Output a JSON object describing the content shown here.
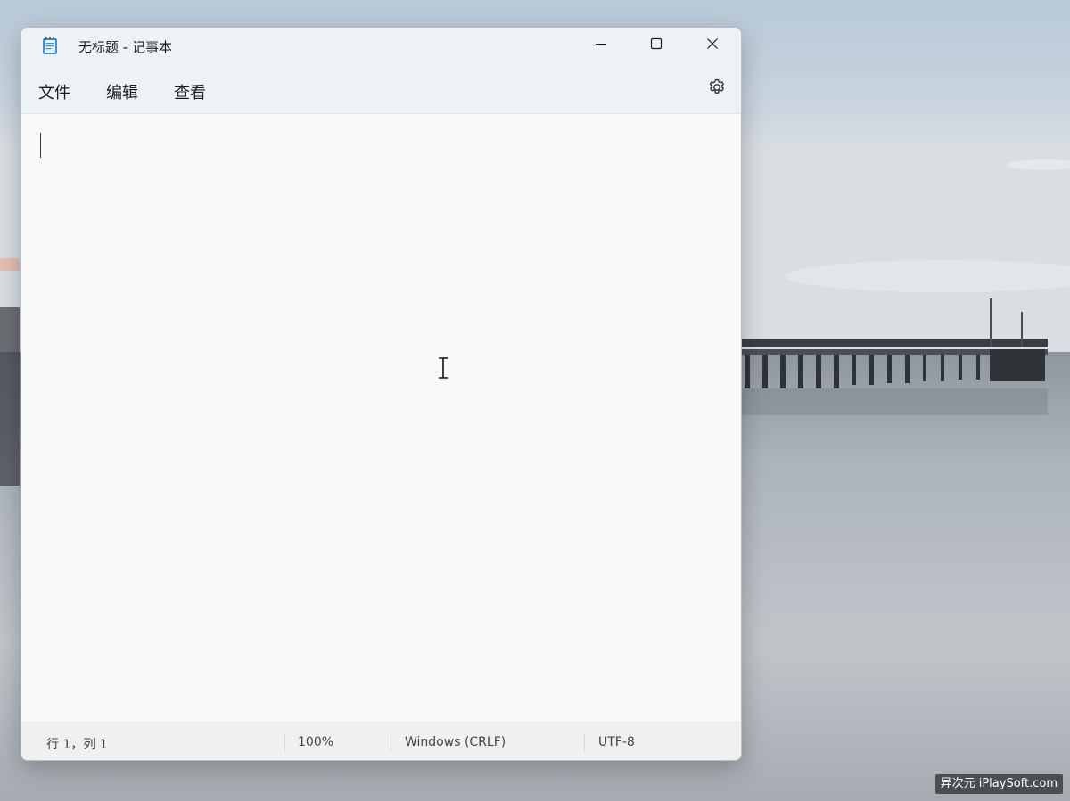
{
  "window": {
    "title": "无标题 - 记事本",
    "app_icon": "notepad-icon"
  },
  "caption_buttons": {
    "minimize": "minimize-icon",
    "maximize": "maximize-icon",
    "close": "close-icon"
  },
  "menu": {
    "items": [
      {
        "label": "文件"
      },
      {
        "label": "编辑"
      },
      {
        "label": "查看"
      }
    ],
    "settings_icon": "gear-icon"
  },
  "editor": {
    "content": ""
  },
  "statusbar": {
    "position": "行 1，列 1",
    "zoom": "100%",
    "line_ending": "Windows (CRLF)",
    "encoding": "UTF-8"
  },
  "watermark": "异次元 iPlaySoft.com",
  "colors": {
    "title_bar": "#edf2f6",
    "editor_bg": "#f9f9f9",
    "status_bar": "#f0f0f0"
  }
}
